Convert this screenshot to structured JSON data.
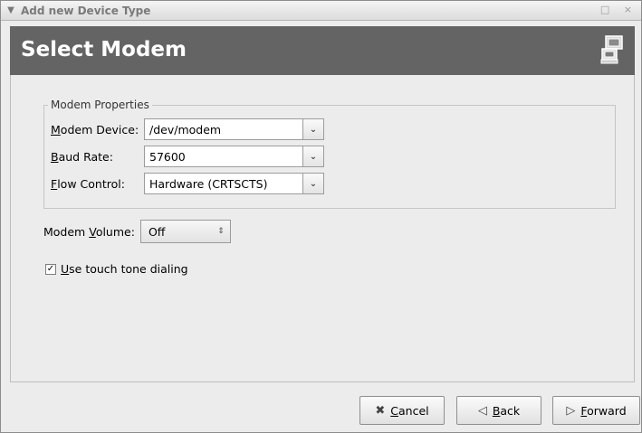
{
  "window": {
    "title": "Add new Device Type",
    "menu_icon": "chevron-down-icon",
    "controls_glyph": "□ ×"
  },
  "header": {
    "title": "Select Modem",
    "icon": "modem-computer-icon"
  },
  "modem_properties": {
    "legend": "Modem Properties",
    "device": {
      "label_u": "M",
      "label_rest": "odem Device:",
      "value": "/dev/modem"
    },
    "baud": {
      "label_u": "B",
      "label_rest": "aud Rate:",
      "value": "57600"
    },
    "flow": {
      "label_u": "F",
      "label_rest": "low Control:",
      "value": "Hardware (CRTSCTS)"
    }
  },
  "volume": {
    "label_pre": "Modem ",
    "label_u": "V",
    "label_rest": "olume:",
    "value": "Off"
  },
  "touch_tone": {
    "checked": true,
    "label_u": "U",
    "label_rest": "se touch tone dialing"
  },
  "buttons": {
    "cancel": {
      "u": "C",
      "rest": "ancel",
      "icon": "x-icon"
    },
    "back": {
      "u": "B",
      "rest": "ack",
      "icon": "back-arrow-icon"
    },
    "forward": {
      "u": "F",
      "rest": "orward",
      "icon": "forward-arrow-icon"
    }
  },
  "colors": {
    "banner": "#646464",
    "window_bg": "#ececec"
  }
}
